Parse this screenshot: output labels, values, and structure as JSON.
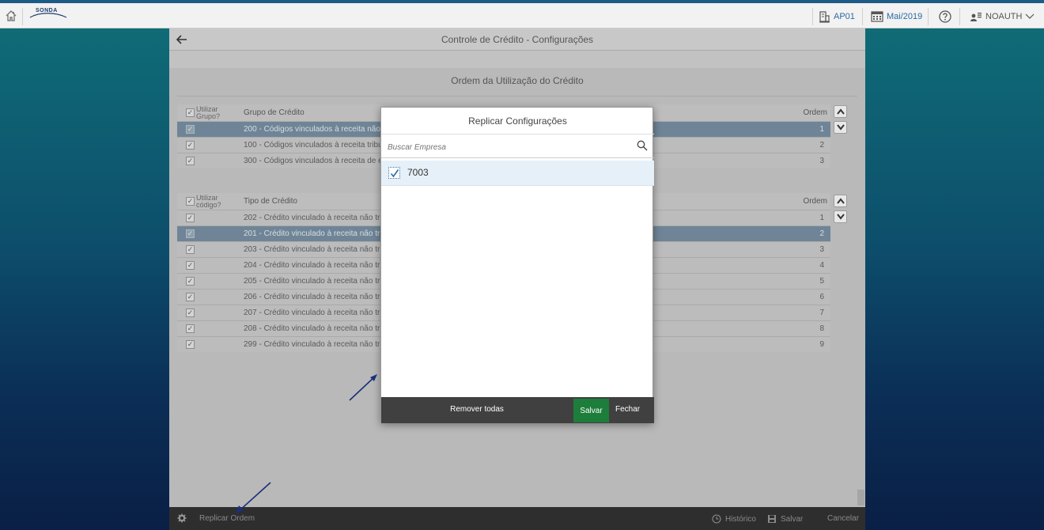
{
  "topbar": {
    "logo_text": "SONDA",
    "company": "AP01",
    "period": "Mai/2019",
    "user": "NOAUTH"
  },
  "page": {
    "title": "Controle de Crédito - Configurações",
    "section_title": "Ordem da Utilização do Crédito"
  },
  "group_grid": {
    "use_label": "Utilizar Grupo?",
    "col_label": "Grupo de Crédito",
    "order_label": "Ordem",
    "rows": [
      {
        "text": "200 - Códigos vinculados à receita não t",
        "order": "1"
      },
      {
        "text": "100 - Códigos vinculados à receita tribut",
        "order": "2"
      },
      {
        "text": "300 - Códigos vinculados à receita de ex",
        "order": "3"
      }
    ]
  },
  "type_grid": {
    "use_label": "Utilizar código?",
    "col_label": "Tipo de Crédito",
    "order_label": "Ordem",
    "rows": [
      {
        "text": "202 - Crédito vinculado à receita não trib",
        "order": "1"
      },
      {
        "text": "201 - Crédito vinculado à receita não trib",
        "order": "2"
      },
      {
        "text": "203 - Crédito vinculado à receita não trib",
        "order": "3"
      },
      {
        "text": "204 - Crédito vinculado à receita não trib",
        "order": "4"
      },
      {
        "text": "205 - Crédito vinculado à receita não trib",
        "order": "5"
      },
      {
        "text": "206 - Crédito vinculado à receita não trib",
        "order": "6"
      },
      {
        "text": "207 - Crédito vinculado à receita não trib",
        "order": "7"
      },
      {
        "text": "208 - Crédito vinculado à receita não trib",
        "order": "8"
      },
      {
        "text": "299 - Crédito vinculado à receita não trib",
        "order": "9"
      }
    ]
  },
  "modal": {
    "title": "Replicar Configurações",
    "search_placeholder": "Buscar Empresa",
    "items": [
      {
        "label": "7003",
        "checked": true
      }
    ],
    "remove_all": "Remover todas",
    "save": "Salvar",
    "close": "Fechar"
  },
  "bottom_bar": {
    "replicate": "Replicar Ordem",
    "history": "Histórico",
    "save": "Salvar",
    "cancel": "Cancelar"
  },
  "colors": {
    "accent": "#2b6aa6",
    "save_green": "#1d7d3a",
    "selected_row": "#6f8597"
  }
}
